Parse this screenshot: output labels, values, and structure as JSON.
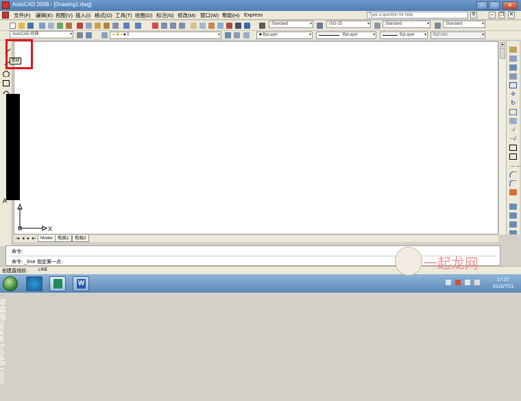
{
  "window": {
    "title": "AutoCAD 2008 - [Drawing1.dwg]"
  },
  "menubar": {
    "items": [
      "文件(F)",
      "编辑(E)",
      "视图(V)",
      "插入(I)",
      "格式(O)",
      "工具(T)",
      "绘图(D)",
      "标注(N)",
      "修改(M)",
      "窗口(W)",
      "帮助(H)",
      "Express"
    ],
    "help_placeholder": "Type a question for help"
  },
  "toolbar2": {
    "workspace": "AutoCAD 经典",
    "layer": "0"
  },
  "styles": {
    "text_style": "Standard",
    "dim_style": "ISO-25",
    "table_style": "Standard",
    "multileader_style": "Standard"
  },
  "properties": {
    "color": "ByLayer",
    "linetype": "ByLayer",
    "lineweight": "ByLayer",
    "plotstyle": "ByColor"
  },
  "tooltip": {
    "text": "直线"
  },
  "tabs": [
    "Model",
    "布局1",
    "布局2"
  ],
  "ucs": {
    "x_label": "X",
    "y_label": "Y"
  },
  "command": {
    "line1": "命令:",
    "line2": "命令: _line 指定第一点:"
  },
  "status": {
    "text": "创建直线段:",
    "value": "LINE"
  },
  "clock": {
    "time": "17:27",
    "date": "2016/7/11"
  },
  "watermarks": {
    "left": "放肆吧/www.fun48.com",
    "right": "一起龙网"
  },
  "colors": {
    "title_bar": "#5f8cc0",
    "highlight_red": "#e0141a"
  }
}
